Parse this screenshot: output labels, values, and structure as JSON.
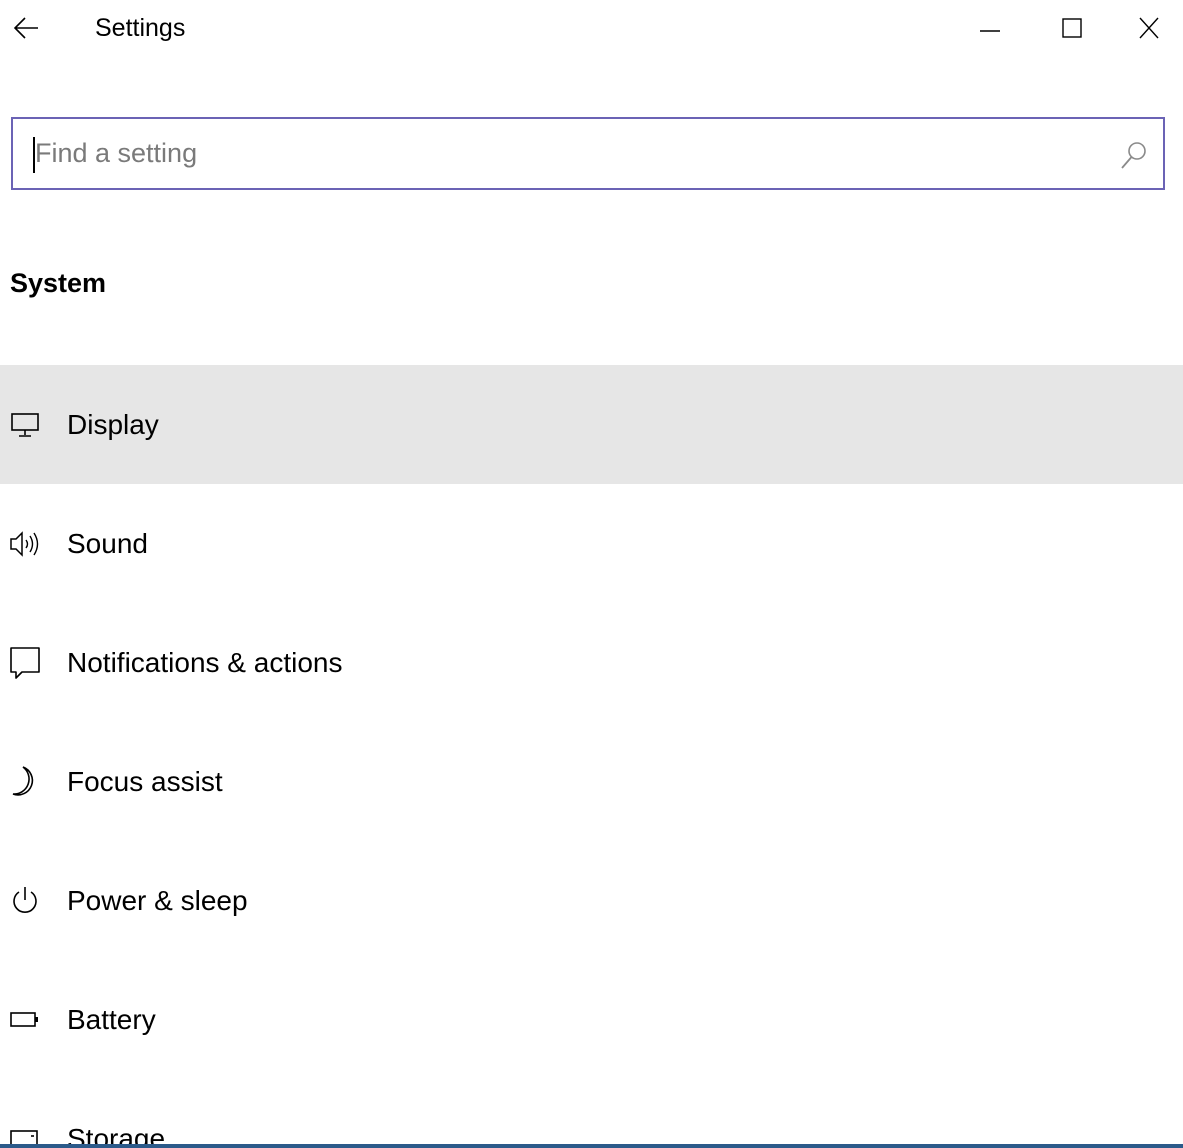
{
  "window": {
    "title": "Settings",
    "controls": {
      "back_icon": "arrow-left-icon",
      "minimize_icon": "minimize-icon",
      "maximize_icon": "maximize-icon",
      "close_icon": "close-icon"
    }
  },
  "search": {
    "placeholder": "Find a setting",
    "value": "",
    "icon": "search-icon",
    "border_color": "#6b63b5"
  },
  "section": {
    "title": "System"
  },
  "nav": {
    "selected_index": 0,
    "selected_bg": "#e6e6e6",
    "items": [
      {
        "label": "Display",
        "icon": "monitor-icon"
      },
      {
        "label": "Sound",
        "icon": "speaker-icon"
      },
      {
        "label": "Notifications & actions",
        "icon": "notification-icon"
      },
      {
        "label": "Focus assist",
        "icon": "moon-icon"
      },
      {
        "label": "Power & sleep",
        "icon": "power-icon"
      },
      {
        "label": "Battery",
        "icon": "battery-icon"
      },
      {
        "label": "Storage",
        "icon": "storage-icon"
      }
    ]
  }
}
